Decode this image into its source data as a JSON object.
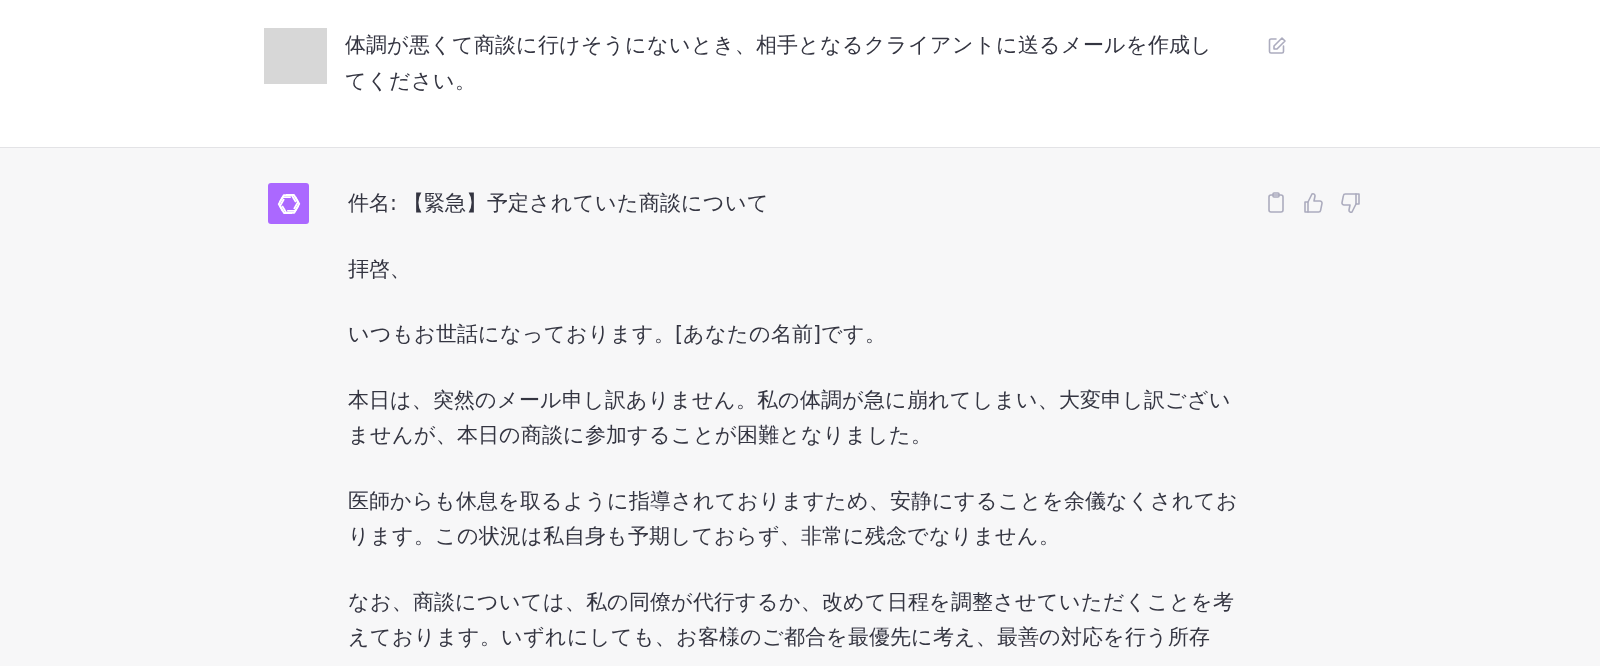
{
  "user_message": {
    "text": "体調が悪くて商談に行けそうにないとき、相手となるクライアントに送るメールを作成してください。"
  },
  "assistant_message": {
    "paragraphs": [
      "件名: 【緊急】予定されていた商談について",
      "拝啓、",
      "いつもお世話になっております。[あなたの名前]です。",
      "本日は、突然のメール申し訳ありません。私の体調が急に崩れてしまい、大変申し訳ございませんが、本日の商談に参加することが困難となりました。",
      "医師からも休息を取るように指導されておりますため、安静にすることを余儀なくされております。この状況は私自身も予期しておらず、非常に残念でなりません。",
      "なお、商談については、私の同僚が代行するか、改めて日程を調整させていただくことを考えております。いずれにしても、お客様のご都合を最優先に考え、最善の対応を行う所存"
    ]
  }
}
